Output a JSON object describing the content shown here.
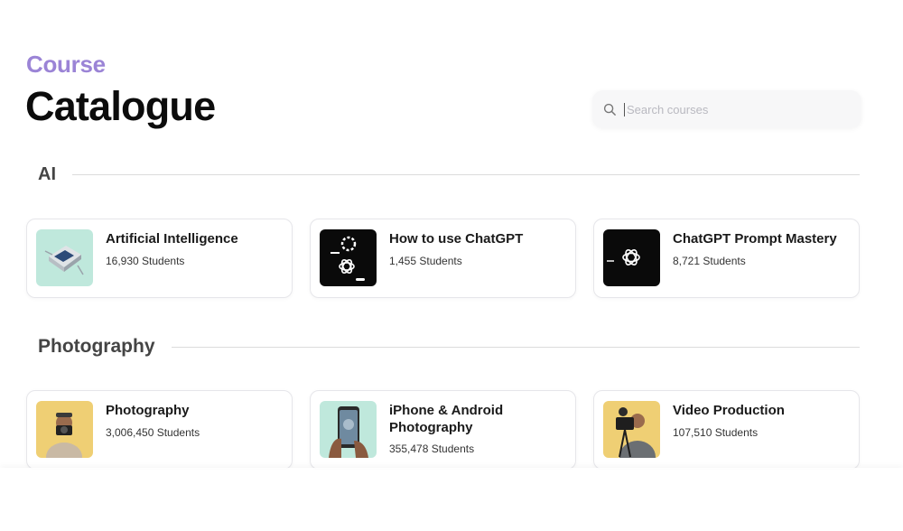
{
  "header": {
    "eyebrow": "Course",
    "title": "Catalogue"
  },
  "search": {
    "placeholder": "Search courses"
  },
  "sections": [
    {
      "title": "AI",
      "courses": [
        {
          "title": "Artificial Intelligence",
          "students": "16,930 Students",
          "thumb": "ai-chip-image"
        },
        {
          "title": "How to use ChatGPT",
          "students": "1,455 Students",
          "thumb": "chatgpt-logo-image"
        },
        {
          "title": "ChatGPT Prompt Mastery",
          "students": "8,721 Students",
          "thumb": "chatgpt-prompt-image"
        }
      ]
    },
    {
      "title": "Photography",
      "courses": [
        {
          "title": "Photography",
          "students": "3,006,450 Students",
          "thumb": "photographer-image"
        },
        {
          "title": "iPhone & Android Photography",
          "students": "355,478 Students",
          "thumb": "phone-camera-image"
        },
        {
          "title": "Video Production",
          "students": "107,510 Students",
          "thumb": "videographer-image"
        }
      ]
    }
  ],
  "colors": {
    "accent": "#9b84d6",
    "title": "#0c0c0c",
    "mint": "#bfe8dc",
    "yellow": "#efcf74"
  },
  "icons": {
    "search": "search-icon"
  }
}
